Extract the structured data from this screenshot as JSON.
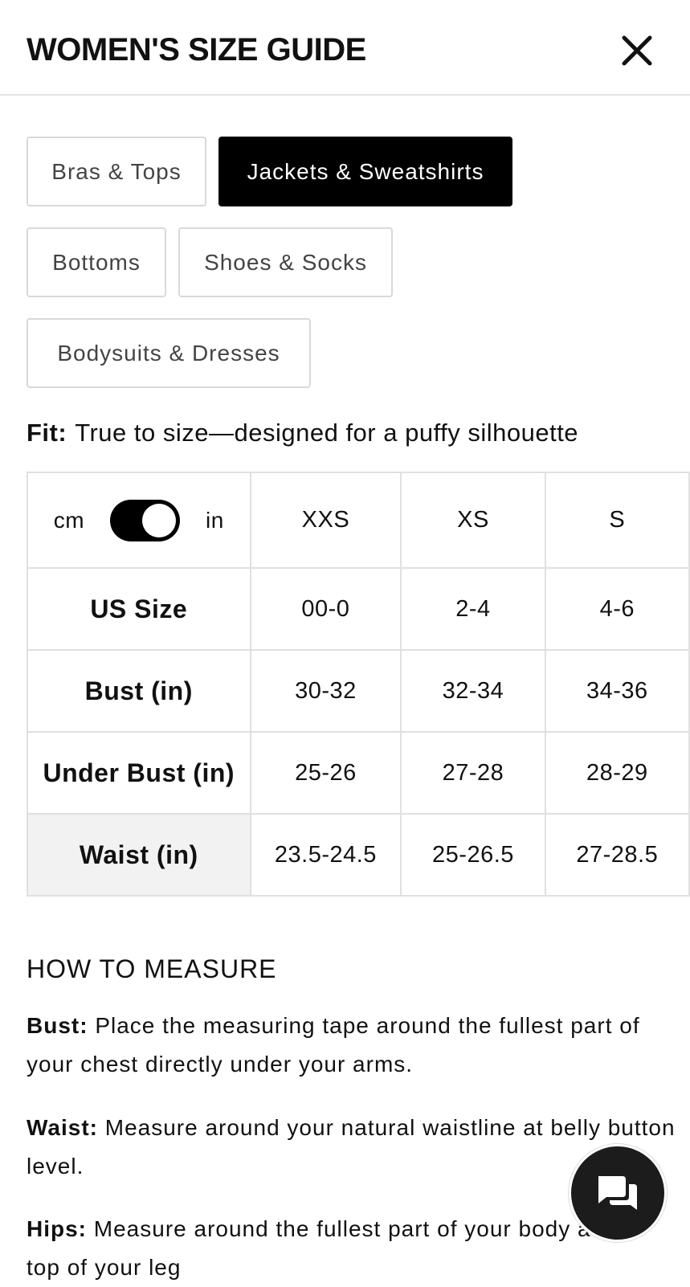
{
  "header": {
    "title": "WOMEN'S SIZE GUIDE"
  },
  "tabs": [
    {
      "label": "Bras & Tops",
      "active": false
    },
    {
      "label": "Jackets & Sweatshirts",
      "active": true
    },
    {
      "label": "Bottoms",
      "active": false
    },
    {
      "label": "Shoes & Socks",
      "active": false
    },
    {
      "label": "Bodysuits & Dresses",
      "active": false
    }
  ],
  "fit": {
    "label": "Fit:",
    "text": "True to size—designed for a puffy silhouette"
  },
  "size_table": {
    "unit_toggle": {
      "left": "cm",
      "right": "in",
      "selected": "in"
    },
    "sizes": [
      "XXS",
      "XS",
      "S"
    ],
    "rows": [
      {
        "label": "US Size",
        "values": [
          "00-0",
          "2-4",
          "4-6"
        ]
      },
      {
        "label": "Bust (in)",
        "values": [
          "30-32",
          "32-34",
          "34-36"
        ]
      },
      {
        "label": "Under Bust (in)",
        "values": [
          "25-26",
          "27-28",
          "28-29"
        ]
      },
      {
        "label": "Waist (in)",
        "values": [
          "23.5-24.5",
          "25-26.5",
          "27-28.5"
        ]
      }
    ]
  },
  "how_to_measure": {
    "title": "HOW TO MEASURE",
    "items": [
      {
        "term": "Bust:",
        "text": "Place the measuring tape around the fullest part of your chest directly under your arms."
      },
      {
        "term": "Waist:",
        "text": "Measure around your natural waistline at belly button level."
      },
      {
        "term": "Hips:",
        "text": "Measure around the fullest part of your body at the top of your leg"
      }
    ]
  },
  "colors": {
    "active_tab_bg": "#000000",
    "border": "#d9d9d9",
    "shaded_cell": "#f2f2f2",
    "chat_button": "#1c1c1c"
  },
  "icons": {
    "close": "close-icon",
    "chat": "chat-icon"
  }
}
